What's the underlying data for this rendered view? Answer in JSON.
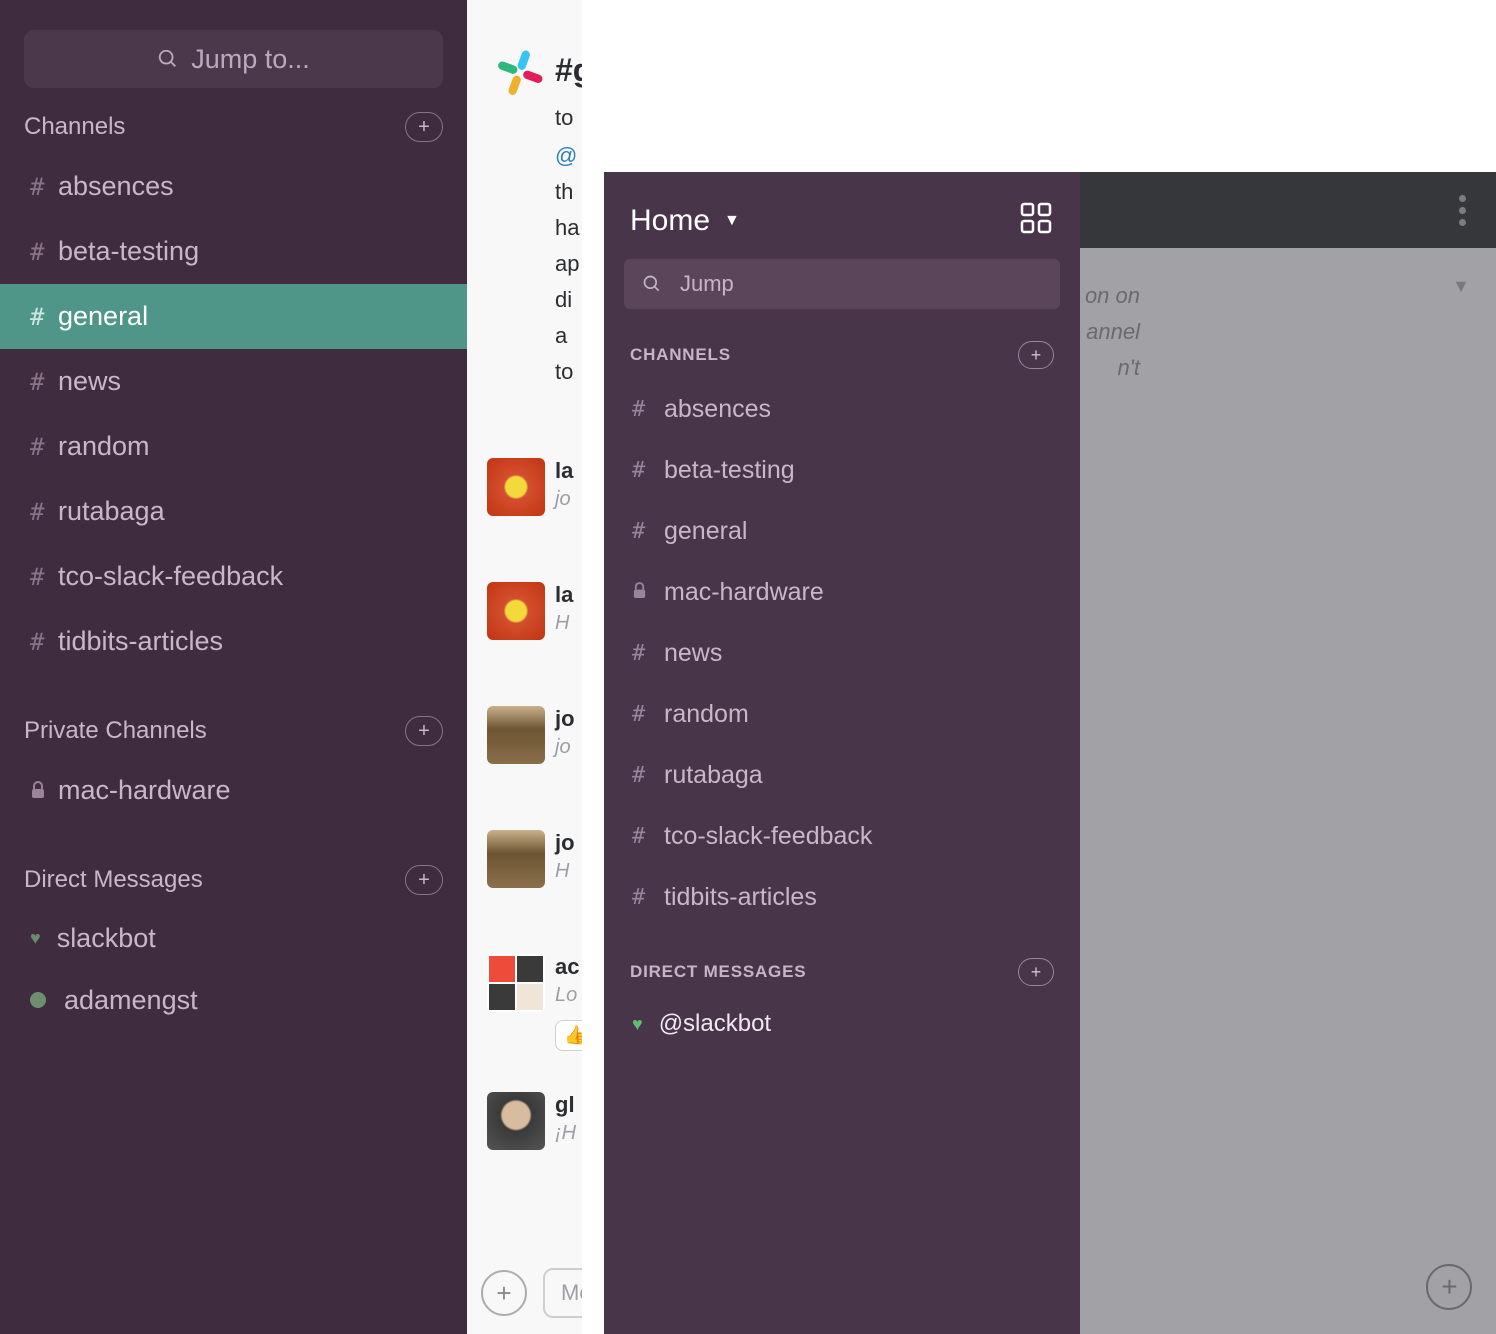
{
  "left": {
    "jump_placeholder": "Jump to...",
    "sections": {
      "channels": "Channels",
      "private": "Private Channels",
      "dms": "Direct Messages"
    },
    "channels": [
      {
        "name": "absences",
        "active": false
      },
      {
        "name": "beta-testing",
        "active": false
      },
      {
        "name": "general",
        "active": true
      },
      {
        "name": "news",
        "active": false
      },
      {
        "name": "random",
        "active": false
      },
      {
        "name": "rutabaga",
        "active": false
      },
      {
        "name": "tco-slack-feedback",
        "active": false
      },
      {
        "name": "tidbits-articles",
        "active": false
      }
    ],
    "private_channels": [
      {
        "name": "mac-hardware"
      }
    ],
    "dms": [
      {
        "name": "slackbot",
        "heart": true
      },
      {
        "name": "adamengst",
        "heart": false
      }
    ]
  },
  "middle": {
    "channel_frag": "#g",
    "line_to": "to",
    "mention_frag": "@",
    "body_lines": [
      "th",
      "ha",
      "ap",
      "di",
      "a",
      "to"
    ],
    "msgs": [
      {
        "user": "la",
        "sub": "jo",
        "avatar": "flower"
      },
      {
        "user": "la",
        "sub": "H",
        "avatar": "flower"
      },
      {
        "user": "jo",
        "sub": "jo",
        "avatar": "helmet"
      },
      {
        "user": "jo",
        "sub": "H",
        "avatar": "helmet"
      },
      {
        "user": "ac",
        "sub": "Lo",
        "avatar": "squares"
      },
      {
        "user": "gl",
        "sub": "¡H",
        "avatar": "person"
      }
    ],
    "compose_placeholder": "Mes"
  },
  "mobile": {
    "header": "Home",
    "jump_placeholder": "Jump",
    "sections": {
      "channels": "CHANNELS",
      "dms": "DIRECT MESSAGES"
    },
    "channels": [
      {
        "name": "absences",
        "locked": false
      },
      {
        "name": "beta-testing",
        "locked": false
      },
      {
        "name": "general",
        "locked": false
      },
      {
        "name": "mac-hardware",
        "locked": true
      },
      {
        "name": "news",
        "locked": false
      },
      {
        "name": "random",
        "locked": false
      },
      {
        "name": "rutabaga",
        "locked": false
      },
      {
        "name": "tco-slack-feedback",
        "locked": false
      },
      {
        "name": "tidbits-articles",
        "locked": false
      }
    ],
    "dms": [
      {
        "name": "@slackbot"
      }
    ],
    "dim_text_lines": [
      "on on",
      "annel",
      "n't"
    ]
  }
}
